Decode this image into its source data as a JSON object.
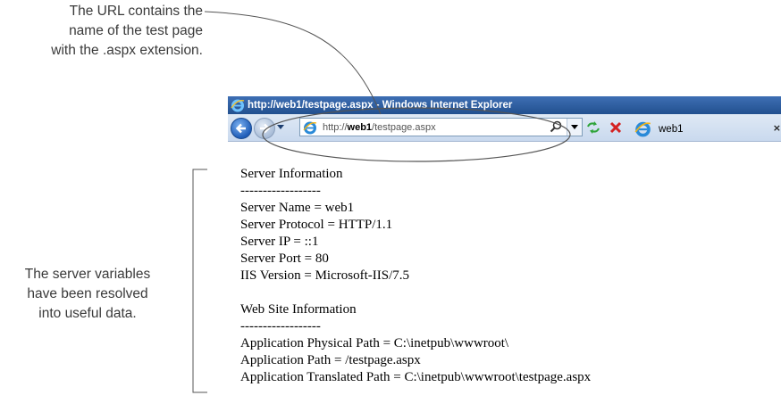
{
  "callouts": {
    "top": [
      "The URL contains the",
      "name of the test page",
      "with the .aspx extension."
    ],
    "left": [
      "The server variables",
      "have been resolved",
      "into useful data."
    ]
  },
  "window": {
    "title": "http://web1/testpage.aspx - Windows Internet Explorer",
    "app_icon": "ie-icon"
  },
  "toolbar": {
    "back_icon": "back-arrow-icon",
    "forward_icon": "forward-arrow-icon",
    "address_prefix": "http://",
    "address_host": "web1",
    "address_path": "/testpage.aspx",
    "search_icon": "search-icon",
    "refresh_icon": "refresh-icon",
    "stop_icon": "stop-icon"
  },
  "tab": {
    "label": "web1",
    "close": "×"
  },
  "content": {
    "lines": [
      "Server Information",
      "------------------",
      "Server Name = web1",
      "Server Protocol = HTTP/1.1",
      "Server IP = ::1",
      "Server Port = 80",
      "IIS Version = Microsoft-IIS/7.5",
      "",
      "Web Site Information",
      "------------------",
      "Application Physical Path = C:\\inetpub\\wwwroot\\",
      "Application Path = /testpage.aspx",
      "Application Translated Path = C:\\inetpub\\wwwroot\\testpage.aspx"
    ]
  },
  "colors": {
    "title_bar": "#22508f",
    "toolbar": "#c9d9ee",
    "annotation_line": "#555555"
  }
}
